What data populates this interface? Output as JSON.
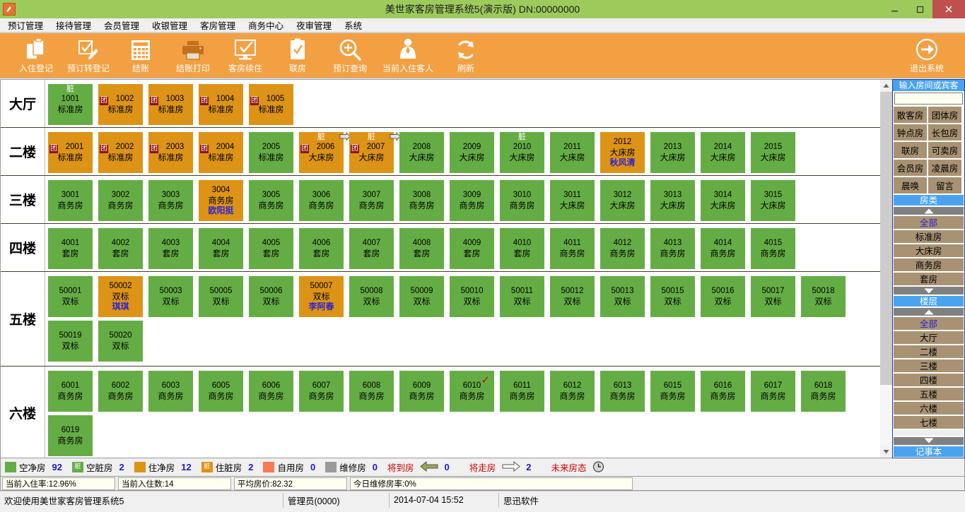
{
  "window": {
    "title": "美世家客房管理系统5(演示版) DN:00000000",
    "app_icon": "hotel-icon",
    "minimize": "—",
    "maximize": "❐",
    "close": "×"
  },
  "menubar": [
    {
      "label": "预订管理"
    },
    {
      "label": "接待管理"
    },
    {
      "label": "会员管理"
    },
    {
      "label": "收银管理"
    },
    {
      "label": "客房管理"
    },
    {
      "label": "商务中心"
    },
    {
      "label": "夜审管理"
    },
    {
      "label": "系统"
    }
  ],
  "toolbar": [
    {
      "label": "入住登记",
      "icon": "checkin-icon"
    },
    {
      "label": "预订转登记",
      "icon": "edit-checklist-icon"
    },
    {
      "label": "结账",
      "icon": "calculator-icon"
    },
    {
      "label": "结账打印",
      "icon": "printer-icon"
    },
    {
      "label": "客房续住",
      "icon": "monitor-check-icon"
    },
    {
      "label": "联房",
      "icon": "clipboard-check-icon"
    },
    {
      "label": "预订查询",
      "icon": "search-plus-icon"
    },
    {
      "label": "当前入住客人",
      "icon": "person-icon"
    },
    {
      "label": "刷新",
      "icon": "refresh-icon"
    }
  ],
  "toolbar_exit": {
    "label": "退出系统",
    "icon": "exit-arrow-icon"
  },
  "floors": [
    {
      "name": "大厅",
      "tall": false,
      "rooms": [
        {
          "no": "1001",
          "type": "标准房",
          "status": "green",
          "dirty": "脏"
        },
        {
          "no": "1002",
          "type": "标准房",
          "status": "orange",
          "group": "团"
        },
        {
          "no": "1003",
          "type": "标准房",
          "status": "orange",
          "group": "团"
        },
        {
          "no": "1004",
          "type": "标准房",
          "status": "orange",
          "group": "团"
        },
        {
          "no": "1005",
          "type": "标准房",
          "status": "orange",
          "group": "团"
        }
      ]
    },
    {
      "name": "二楼",
      "tall": false,
      "rooms": [
        {
          "no": "2001",
          "type": "标准房",
          "status": "orange",
          "group": "团"
        },
        {
          "no": "2002",
          "type": "标准房",
          "status": "orange",
          "group": "团"
        },
        {
          "no": "2003",
          "type": "标准房",
          "status": "orange",
          "group": "团"
        },
        {
          "no": "2004",
          "type": "标准房",
          "status": "orange",
          "group": "团"
        },
        {
          "no": "2005",
          "type": "标准房",
          "status": "green"
        },
        {
          "no": "2006",
          "type": "大床房",
          "status": "orange",
          "group": "团",
          "dirty": "脏",
          "leaving": true
        },
        {
          "no": "2007",
          "type": "大床房",
          "status": "orange",
          "group": "团",
          "dirty": "脏",
          "leaving": true
        },
        {
          "no": "2008",
          "type": "大床房",
          "status": "green"
        },
        {
          "no": "2009",
          "type": "大床房",
          "status": "green"
        },
        {
          "no": "2010",
          "type": "大床房",
          "status": "green",
          "dirty": "脏"
        },
        {
          "no": "2011",
          "type": "大床房",
          "status": "green"
        },
        {
          "no": "2012",
          "type": "大床房",
          "status": "orange",
          "guest": "秋风清"
        },
        {
          "no": "2013",
          "type": "大床房",
          "status": "green"
        },
        {
          "no": "2014",
          "type": "大床房",
          "status": "green"
        },
        {
          "no": "2015",
          "type": "大床房",
          "status": "green"
        }
      ]
    },
    {
      "name": "三楼",
      "tall": false,
      "rooms": [
        {
          "no": "3001",
          "type": "商务房",
          "status": "green"
        },
        {
          "no": "3002",
          "type": "商务房",
          "status": "green"
        },
        {
          "no": "3003",
          "type": "商务房",
          "status": "green"
        },
        {
          "no": "3004",
          "type": "商务房",
          "status": "orange",
          "guest": "欧阳挺"
        },
        {
          "no": "3005",
          "type": "商务房",
          "status": "green"
        },
        {
          "no": "3006",
          "type": "商务房",
          "status": "green"
        },
        {
          "no": "3007",
          "type": "商务房",
          "status": "green"
        },
        {
          "no": "3008",
          "type": "商务房",
          "status": "green"
        },
        {
          "no": "3009",
          "type": "商务房",
          "status": "green"
        },
        {
          "no": "3010",
          "type": "商务房",
          "status": "green"
        },
        {
          "no": "3011",
          "type": "大床房",
          "status": "green"
        },
        {
          "no": "3012",
          "type": "大床房",
          "status": "green"
        },
        {
          "no": "3013",
          "type": "大床房",
          "status": "green"
        },
        {
          "no": "3014",
          "type": "大床房",
          "status": "green"
        },
        {
          "no": "3015",
          "type": "大床房",
          "status": "green"
        }
      ]
    },
    {
      "name": "四楼",
      "tall": false,
      "rooms": [
        {
          "no": "4001",
          "type": "套房",
          "status": "green"
        },
        {
          "no": "4002",
          "type": "套房",
          "status": "green"
        },
        {
          "no": "4003",
          "type": "套房",
          "status": "green"
        },
        {
          "no": "4004",
          "type": "套房",
          "status": "green"
        },
        {
          "no": "4005",
          "type": "套房",
          "status": "green"
        },
        {
          "no": "4006",
          "type": "套房",
          "status": "green"
        },
        {
          "no": "4007",
          "type": "套房",
          "status": "green"
        },
        {
          "no": "4008",
          "type": "套房",
          "status": "green"
        },
        {
          "no": "4009",
          "type": "套房",
          "status": "green"
        },
        {
          "no": "4010",
          "type": "套房",
          "status": "green"
        },
        {
          "no": "4011",
          "type": "商务房",
          "status": "green"
        },
        {
          "no": "4012",
          "type": "商务房",
          "status": "green"
        },
        {
          "no": "4013",
          "type": "商务房",
          "status": "green"
        },
        {
          "no": "4014",
          "type": "商务房",
          "status": "green"
        },
        {
          "no": "4015",
          "type": "商务房",
          "status": "green"
        }
      ]
    },
    {
      "name": "五楼",
      "tall": true,
      "rooms": [
        {
          "no": "50001",
          "type": "双标",
          "status": "green"
        },
        {
          "no": "50002",
          "type": "双标",
          "status": "orange",
          "guest": "琪琪"
        },
        {
          "no": "50003",
          "type": "双标",
          "status": "green"
        },
        {
          "no": "50005",
          "type": "双标",
          "status": "green"
        },
        {
          "no": "50006",
          "type": "双标",
          "status": "green"
        },
        {
          "no": "50007",
          "type": "双标",
          "status": "orange",
          "guest": "李阿春"
        },
        {
          "no": "50008",
          "type": "双标",
          "status": "green"
        },
        {
          "no": "50009",
          "type": "双标",
          "status": "green"
        },
        {
          "no": "50010",
          "type": "双标",
          "status": "green"
        },
        {
          "no": "50011",
          "type": "双标",
          "status": "green"
        },
        {
          "no": "50012",
          "type": "双标",
          "status": "green"
        },
        {
          "no": "50013",
          "type": "双标",
          "status": "green"
        },
        {
          "no": "50015",
          "type": "双标",
          "status": "green"
        },
        {
          "no": "50016",
          "type": "双标",
          "status": "green"
        },
        {
          "no": "50017",
          "type": "双标",
          "status": "green"
        },
        {
          "no": "50018",
          "type": "双标",
          "status": "green"
        },
        {
          "no": "50019",
          "type": "双标",
          "status": "green"
        },
        {
          "no": "50020",
          "type": "双标",
          "status": "green"
        }
      ]
    },
    {
      "name": "六楼",
      "tall": false,
      "rooms": [
        {
          "no": "6001",
          "type": "商务房",
          "status": "green"
        },
        {
          "no": "6002",
          "type": "商务房",
          "status": "green"
        },
        {
          "no": "6003",
          "type": "商务房",
          "status": "green"
        },
        {
          "no": "6005",
          "type": "商务房",
          "status": "green"
        },
        {
          "no": "6006",
          "type": "商务房",
          "status": "green"
        },
        {
          "no": "6007",
          "type": "商务房",
          "status": "green"
        },
        {
          "no": "6008",
          "type": "商务房",
          "status": "green"
        },
        {
          "no": "6009",
          "type": "商务房",
          "status": "green"
        },
        {
          "no": "6010",
          "type": "商务房",
          "status": "green",
          "check": "✓"
        },
        {
          "no": "6011",
          "type": "商务房",
          "status": "green"
        },
        {
          "no": "6012",
          "type": "商务房",
          "status": "green"
        },
        {
          "no": "6013",
          "type": "商务房",
          "status": "green"
        },
        {
          "no": "6015",
          "type": "商务房",
          "status": "green"
        },
        {
          "no": "6016",
          "type": "商务房",
          "status": "green"
        },
        {
          "no": "6017",
          "type": "商务房",
          "status": "green"
        },
        {
          "no": "6018",
          "type": "商务房",
          "status": "green"
        },
        {
          "no": "6019",
          "type": "商务房",
          "status": "green"
        }
      ]
    }
  ],
  "right_panel": {
    "header": "输入房间或宾客",
    "search_value": "",
    "buttons": [
      "散客房",
      "团体房",
      "钟点房",
      "长包房",
      "联房",
      "可卖房",
      "会员房",
      "凌晨房",
      "晨唤",
      "留言"
    ],
    "roomtype_section": "房类",
    "roomtype_items": [
      "全部",
      "标准房",
      "大床房",
      "商务房",
      "套房"
    ],
    "roomtype_selected": "全部",
    "floor_section": "楼层",
    "floor_items": [
      "全部",
      "大厅",
      "二楼",
      "三楼",
      "四楼",
      "五楼",
      "六楼",
      "七楼"
    ],
    "floor_selected": "全部",
    "notebook": "记事本",
    "up_arrow": "▲",
    "down_arrow": "▼"
  },
  "legend": {
    "items": [
      {
        "label": "空净房",
        "value": "92",
        "color": "#64ad45",
        "badge": ""
      },
      {
        "label": "空脏房",
        "value": "2",
        "color": "#64ad45",
        "badge": "脏"
      },
      {
        "label": "住净房",
        "value": "12",
        "color": "#dd9316",
        "badge": ""
      },
      {
        "label": "住脏房",
        "value": "2",
        "color": "#dd9316",
        "badge": "脏"
      },
      {
        "label": "自用房",
        "value": "0",
        "color": "#fb7a52",
        "badge": ""
      },
      {
        "label": "维修房",
        "value": "0",
        "color": "#9a9a9a",
        "badge": ""
      }
    ],
    "arriving_label": "将到房",
    "arriving_value": "0",
    "leaving_label": "将走房",
    "leaving_value": "2",
    "future_label": "未来房态"
  },
  "stats": {
    "occupancy_rate": "当前入住率:12.96%",
    "occupied_count": "当前入住数:14",
    "avg_price": "平均房价:82.32",
    "maintenance_rate": "今日维修房率:0%"
  },
  "statusbar": {
    "welcome": "欢迎使用美世家客房管理系统5",
    "user": "管理员(0000)",
    "datetime": "2014-07-04 15:52",
    "vendor": "思迅软件"
  }
}
